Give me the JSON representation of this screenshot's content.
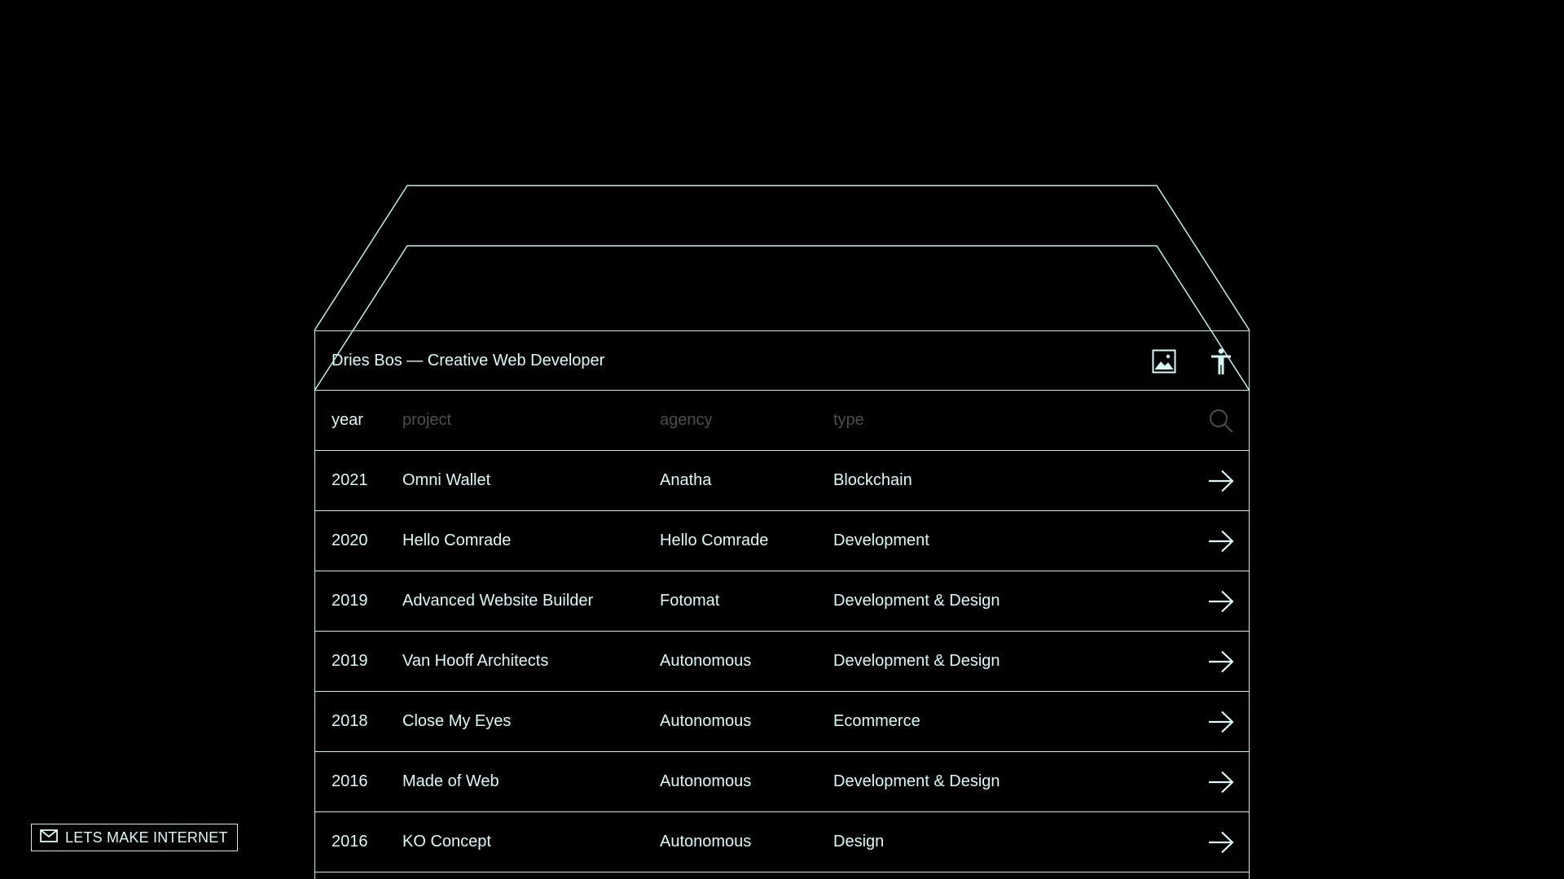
{
  "header": {
    "site_title": "Dries Bos — Creative Web Developer",
    "icons": [
      "image-icon",
      "accessibility-icon"
    ]
  },
  "filters": {
    "year": "year",
    "project": "project",
    "agency": "agency",
    "type": "type",
    "icon": "search-icon"
  },
  "projects": [
    {
      "year": "2021",
      "project": "Omni Wallet",
      "agency": "Anatha",
      "type": "Blockchain"
    },
    {
      "year": "2020",
      "project": "Hello Comrade",
      "agency": "Hello Comrade",
      "type": "Development"
    },
    {
      "year": "2019",
      "project": "Advanced Website Builder",
      "agency": "Fotomat",
      "type": "Development & Design"
    },
    {
      "year": "2019",
      "project": "Van Hooff Architects",
      "agency": "Autonomous",
      "type": "Development & Design"
    },
    {
      "year": "2018",
      "project": "Close My Eyes",
      "agency": "Autonomous",
      "type": "Ecommerce"
    },
    {
      "year": "2016",
      "project": "Made of Web",
      "agency": "Autonomous",
      "type": "Development & Design"
    },
    {
      "year": "2016",
      "project": "KO Concept",
      "agency": "Autonomous",
      "type": "Design"
    }
  ],
  "row_icon": "arrow-right-icon",
  "cta": {
    "label": "LETS MAKE INTERNET",
    "icon": "mail-icon"
  },
  "colors": {
    "background": "#000000",
    "line": "#b8f1ea",
    "text": "#d6fbf8",
    "muted": "#4a4f4f"
  }
}
